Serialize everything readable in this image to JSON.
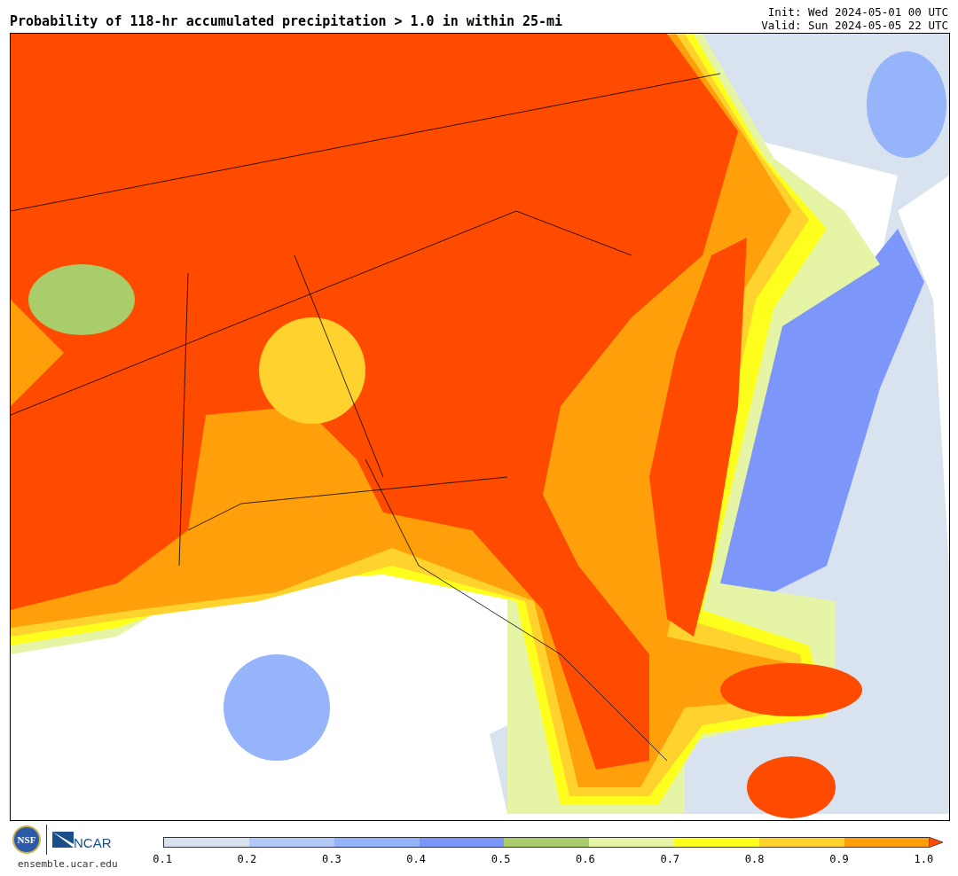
{
  "title": "Probability of 118-hr accumulated precipitation > 1.0 in within 25-mi",
  "init": "Init: Wed 2024-05-01 00 UTC",
  "valid": "Valid: Sun 2024-05-05 22 UTC",
  "logos": {
    "nsf": "NSF",
    "ncar": "NCAR",
    "url": "ensemble.ucar.edu"
  },
  "colorbar": {
    "bins": [
      {
        "kind": "bin",
        "color": "#d8e3ef"
      },
      {
        "kind": "bin",
        "color": "#b4c8fa"
      },
      {
        "kind": "bin",
        "color": "#96b4fa"
      },
      {
        "kind": "bin",
        "color": "#7d96fa"
      },
      {
        "kind": "bin",
        "color": "#a8cd6a"
      },
      {
        "kind": "bin",
        "color": "#e6f5a5"
      },
      {
        "kind": "bin",
        "color": "#ffff1e"
      },
      {
        "kind": "bin",
        "color": "#ffd22d"
      },
      {
        "kind": "bin",
        "color": "#ffa00a"
      },
      {
        "kind": "arrow",
        "color": "#ff4b00"
      }
    ],
    "ticks": [
      "0.1",
      "0.2",
      "0.3",
      "0.4",
      "0.5",
      "0.6",
      "0.7",
      "0.8",
      "0.9",
      "1.0"
    ]
  }
}
